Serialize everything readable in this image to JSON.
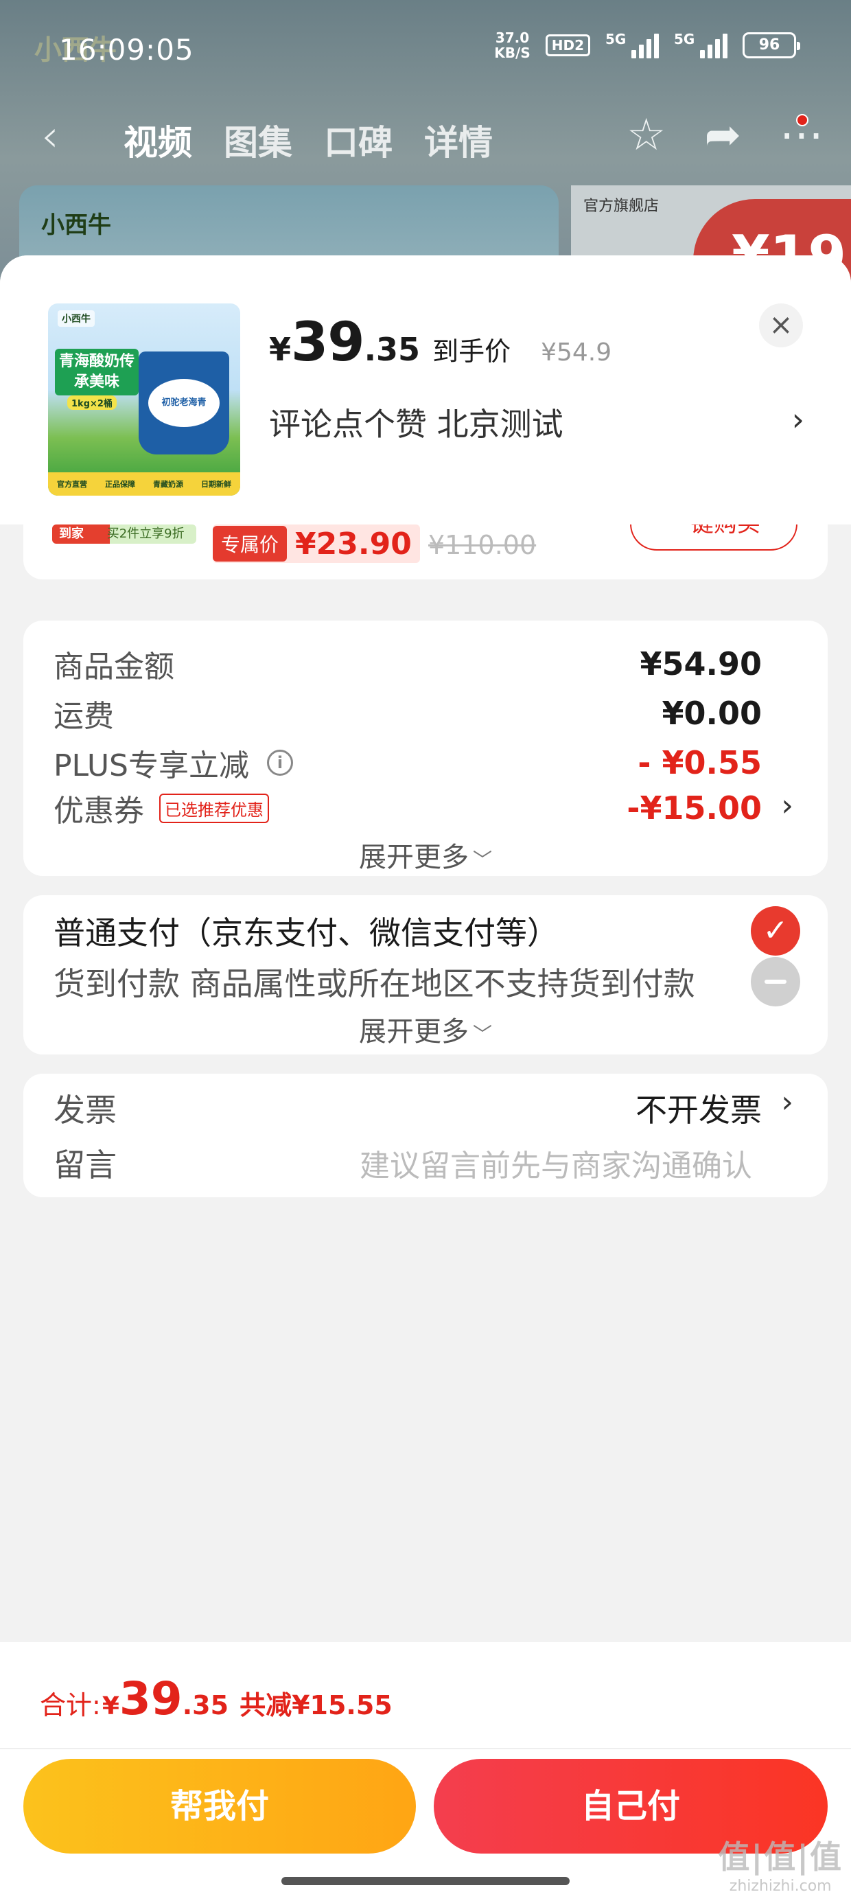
{
  "status_bar": {
    "time": "16:09:05",
    "net_speed_value": "37.0",
    "net_speed_unit": "KB/S",
    "hd_label": "HD2",
    "signal1_label": "5G",
    "signal2_label": "5G",
    "battery": "96"
  },
  "nav": {
    "tabs": [
      "视频",
      "图集",
      "口碑",
      "详情"
    ],
    "back_icon": "chevron-left-icon",
    "icons": [
      "star-icon",
      "share-icon",
      "more-icon"
    ]
  },
  "background": {
    "shop_label": "官方旗舰店",
    "price_partial": "¥19"
  },
  "product": {
    "price_symbol": "¥",
    "price_int": "39",
    "price_dec": ".35",
    "price_tag": "到手价",
    "original_price": "¥54.9",
    "spec": "评论点个赞  北京测试",
    "image": {
      "slogan": "青海酸奶传承美味",
      "spec": "1kg×2桶",
      "bucket_label": "初驼老海青",
      "badges": [
        "官方直营",
        "正品保障",
        "青藏奶源",
        "日期新鲜"
      ]
    }
  },
  "partial_card": {
    "tag_left": "到家",
    "tag_right": "买2件立享9折",
    "exclusive_label": "专属价",
    "exclusive_price": "¥23.90",
    "original_price": "¥110.00",
    "button_label": "一键购买"
  },
  "summary": {
    "items": [
      {
        "label": "商品金额",
        "value": "¥54.90"
      },
      {
        "label": "运费",
        "value": "¥0.00"
      },
      {
        "label": "PLUS专享立减",
        "value": "- ¥0.55"
      },
      {
        "label": "优惠券",
        "tag": "已选推荐优惠",
        "value": "-¥15.00"
      }
    ],
    "expand_label": "展开更多"
  },
  "payment": {
    "options": [
      {
        "label": "普通支付（京东支付、微信支付等）",
        "selected": true
      },
      {
        "label": "货到付款 商品属性或所在地区不支持货到付款",
        "selected": false
      }
    ],
    "expand_label": "展开更多"
  },
  "extras": {
    "invoice_label": "发票",
    "invoice_value": "不开发票",
    "message_label": "留言",
    "message_placeholder": "建议留言前先与商家沟通确认"
  },
  "footer": {
    "total_label": "合计:",
    "total_symbol": "¥",
    "total_int": "39",
    "total_dec": ".35",
    "saving": "共减¥15.55",
    "help_pay_label": "帮我付",
    "self_pay_label": "自己付"
  },
  "watermark": {
    "big": "值|值|值",
    "small": "zhizhizhi.com"
  },
  "colors": {
    "accent_red": "#e2231a",
    "button_yellow": "#fcc21c",
    "button_red": "#f43e4e"
  }
}
